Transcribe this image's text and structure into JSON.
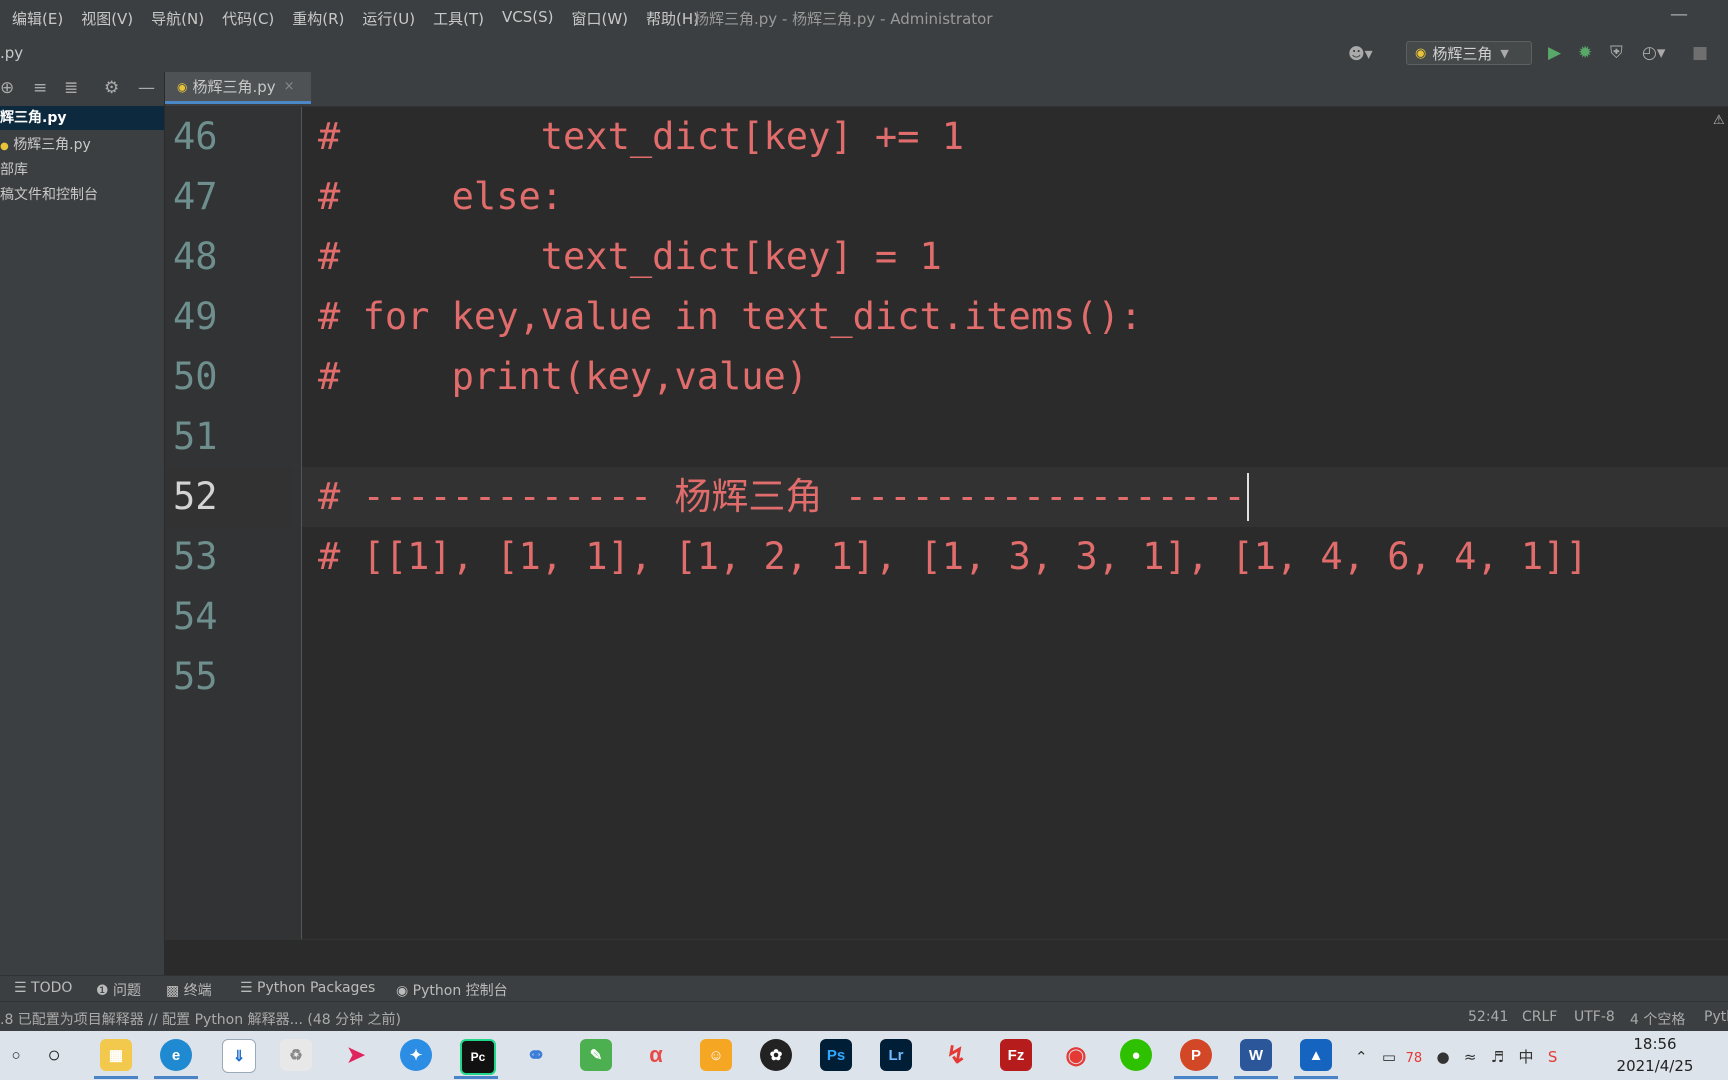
{
  "menu": [
    "编辑(E)",
    "视图(V)",
    "导航(N)",
    "代码(C)",
    "重构(R)",
    "运行(U)",
    "工具(T)",
    "VCS(S)",
    "窗口(W)",
    "帮助(H)"
  ],
  "window_title": "杨辉三角.py - 杨辉三角.py - Administrator",
  "breadcrumb": ".py",
  "run_config": "杨辉三角",
  "project_tree": {
    "root": "辉三角.py",
    "items": [
      "杨辉三角.py",
      "部库",
      "稿文件和控制台"
    ]
  },
  "tab": {
    "label": "杨辉三角.py",
    "close": "×"
  },
  "editor": {
    "current_line": "52",
    "lines": [
      {
        "num": "46",
        "text": "#         text_dict[key] += 1"
      },
      {
        "num": "47",
        "text": "#     else:"
      },
      {
        "num": "48",
        "text": "#         text_dict[key] = 1"
      },
      {
        "num": "49",
        "text": "# for key,value in text_dict.items():"
      },
      {
        "num": "50",
        "text": "#     print(key,value)"
      },
      {
        "num": "51",
        "text": ""
      },
      {
        "num": "52",
        "text": "# ------------- 杨辉三角 ------------------"
      },
      {
        "num": "53",
        "text": "# [[1], [1, 1], [1, 2, 1], [1, 3, 3, 1], [1, 4, 6, 4, 1]]"
      },
      {
        "num": "54",
        "text": ""
      },
      {
        "num": "55",
        "text": ""
      }
    ]
  },
  "tool_windows": [
    "TODO",
    "问题",
    "终端",
    "Python Packages",
    "Python 控制台"
  ],
  "status": {
    "message": ".8 已配置为项目解释器 // 配置 Python 解释器... (48 分钟 之前)",
    "position": "52:41",
    "line_sep": "CRLF",
    "encoding": "UTF-8",
    "indent": "4 个空格",
    "interpreter": "Pyth"
  },
  "taskbar": {
    "apps": [
      "Pc",
      "Ps",
      "Lr",
      "P",
      "W"
    ],
    "battery": "78",
    "ime": "中",
    "time": "18:56",
    "date": "2021/4/25"
  },
  "colors": {
    "code": "#e06c6c",
    "line_number": "#6e8f8e",
    "selection": "#0d293e",
    "accent": "#4a88c7"
  }
}
